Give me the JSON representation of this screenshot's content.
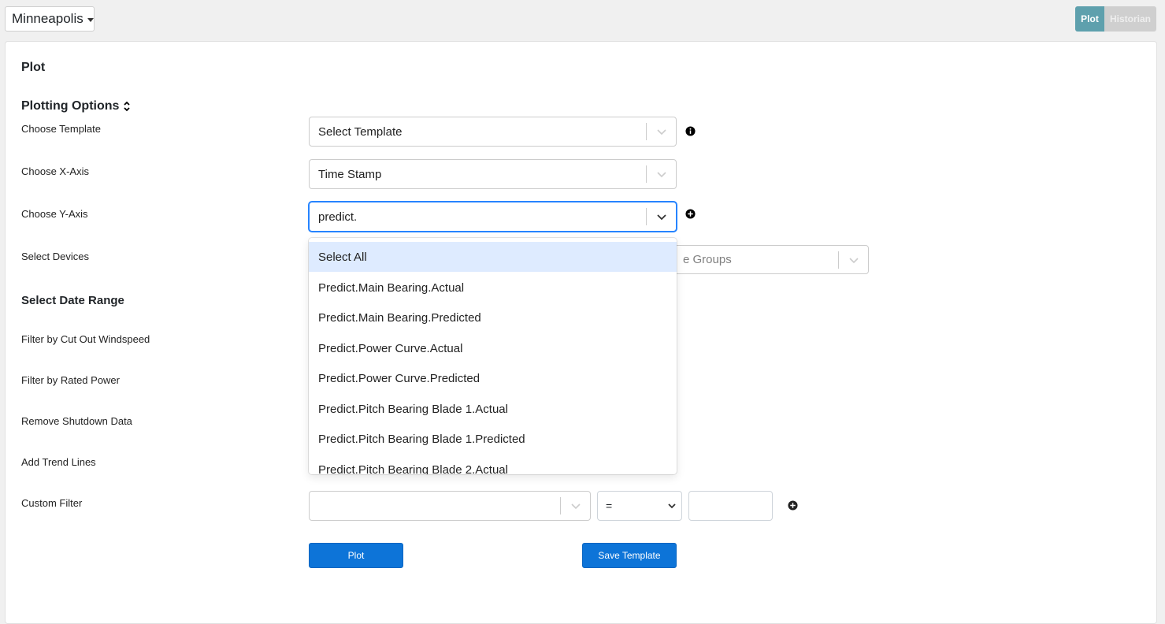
{
  "site_selector": {
    "label": "Minneapolis"
  },
  "view_toggle": {
    "plot": "Plot",
    "historian": "Historian"
  },
  "page_title": "Plot",
  "plotting_options": {
    "heading": "Plotting Options",
    "labels": {
      "template": "Choose Template",
      "x_axis": "Choose X-Axis",
      "y_axis": "Choose Y-Axis",
      "devices": "Select Devices",
      "date_range": "Select Date Range",
      "cut_out": "Filter by Cut Out Windspeed",
      "rated_power": "Filter by Rated Power",
      "shutdown": "Remove Shutdown Data",
      "trend": "Add Trend Lines",
      "custom": "Custom Filter"
    },
    "template_value": "Select Template",
    "x_axis_value": "Time Stamp",
    "y_axis_input": "predict.",
    "device_groups_placeholder": "e Groups",
    "custom_filter": {
      "operator": "=",
      "value": ""
    }
  },
  "y_axis_options": [
    "Select All",
    "Predict.Main Bearing.Actual",
    "Predict.Main Bearing.Predicted",
    "Predict.Power Curve.Actual",
    "Predict.Power Curve.Predicted",
    "Predict.Pitch Bearing Blade 1.Actual",
    "Predict.Pitch Bearing Blade 1.Predicted",
    "Predict.Pitch Bearing Blade 2.Actual"
  ],
  "buttons": {
    "plot": "Plot",
    "save_template": "Save Template"
  },
  "colors": {
    "accent": "#0d74d8",
    "toggle_active": "#5ea0ad",
    "focus": "#2684ff",
    "highlight": "#deebff"
  },
  "icons": {
    "template_info": "info-circle-icon",
    "y_axis_add": "plus-circle-icon",
    "custom_add": "plus-circle-icon",
    "collapse": "double-chevron-icon"
  }
}
